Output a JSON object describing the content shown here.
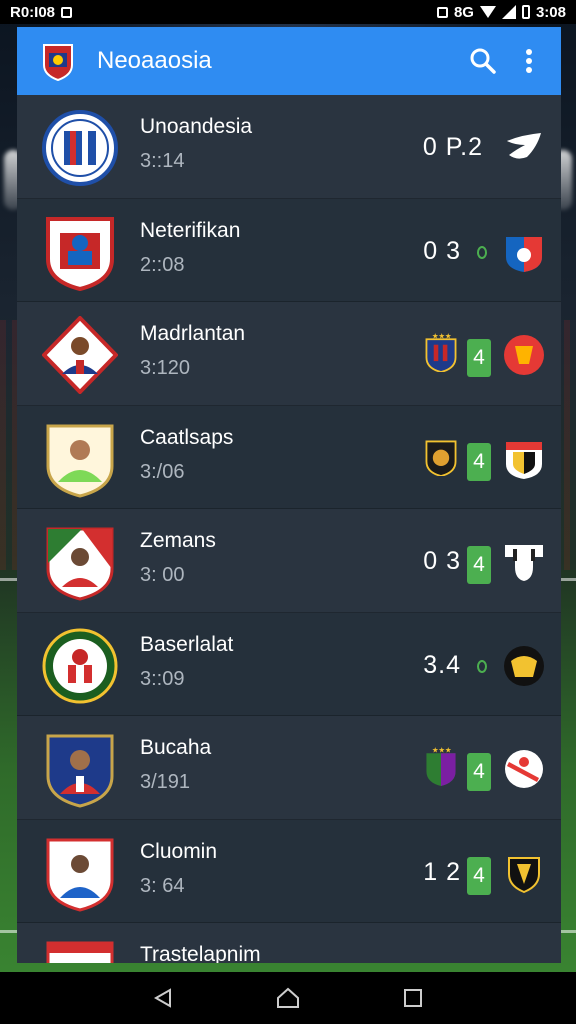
{
  "status_bar": {
    "carrier": "R0:I08",
    "time": "3:08",
    "network": "8G"
  },
  "app_bar": {
    "title": "Neoaaosia",
    "icons": [
      "search-icon",
      "more-vert-icon"
    ],
    "color": "#2f8cf2"
  },
  "matches": [
    {
      "name": "Unoandesia",
      "time": "3::14",
      "score": "0 P.2",
      "crest_colors": [
        "#ffffff",
        "#1f4fa8",
        "#d32f2f"
      ]
    },
    {
      "name": "Neterifikan",
      "time": "2::08",
      "score": "0 3",
      "crest_colors": [
        "#ffffff",
        "#c62828",
        "#1565c0"
      ]
    },
    {
      "name": "Madrlantan",
      "time": "3:120",
      "score": "",
      "badge": "4",
      "crest_colors": [
        "#ffffff",
        "#c62828",
        "#1e3a8a"
      ]
    },
    {
      "name": "Caatlsaps",
      "time": "3:/06",
      "score": "",
      "badge": "4",
      "crest_colors": [
        "#fff6dc",
        "#7ed957",
        "#3a6e2a"
      ]
    },
    {
      "name": "Zemans",
      "time": "3: 00",
      "score": "0 3",
      "badge": "4",
      "crest_colors": [
        "#ffffff",
        "#d32f2f",
        "#2e7d32"
      ]
    },
    {
      "name": "Baserlalat",
      "time": "3::09",
      "score": "3.4",
      "crest_colors": [
        "#ffffff",
        "#d32f2f",
        "#1b5e20"
      ]
    },
    {
      "name": "Bucaha",
      "time": "3/191",
      "score": "",
      "badge": "4",
      "crest_colors": [
        "#1e3a8a",
        "#d32f2f",
        "#ffffff"
      ]
    },
    {
      "name": "Cluomin",
      "time": "3: 64",
      "score": "1 2",
      "badge": "4",
      "crest_colors": [
        "#ffffff",
        "#1e63c8",
        "#d32f2f"
      ]
    },
    {
      "name": "Trastelapnim",
      "time": "",
      "score": "",
      "crest_colors": [
        "#ffffff",
        "#d32f2f",
        "#1e3a8a"
      ]
    }
  ],
  "nav_bar": {
    "icons": [
      "back-icon",
      "home-icon",
      "recents-icon"
    ]
  }
}
